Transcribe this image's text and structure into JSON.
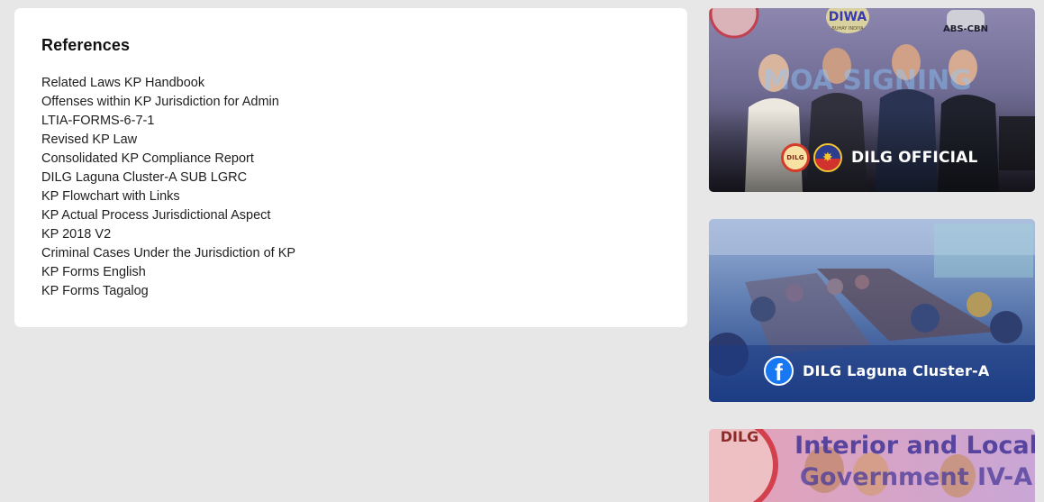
{
  "references": {
    "title": "References",
    "items": [
      "Related Laws KP Handbook",
      "Offenses within KP Jurisdiction for Admin",
      "LTIA-FORMS-6-7-1",
      "Revised KP Law",
      "Consolidated KP Compliance Report",
      "DILG Laguna Cluster-A SUB LGRC",
      "KP Flowchart with Links",
      "KP Actual Process Jurisdictional Aspect",
      "KP 2018 V2",
      "Criminal Cases Under the Jurisdiction of KP",
      "KP Forms English",
      "KP Forms Tagalog"
    ]
  },
  "banners": {
    "official": {
      "caption": "DILG OFFICIAL",
      "seal_text": "DILG",
      "backdrop_text": "MOA SIGNING",
      "top_logo": "DIWA",
      "top_logo_sub": "BUHAY INDIYA",
      "network": "ABS-CBN"
    },
    "facebook": {
      "caption": "DILG Laguna Cluster-A",
      "icon_glyph": "f"
    },
    "regional": {
      "line1": "Interior and Local",
      "line2": "Government IV-A",
      "seal_text": "DILG"
    }
  },
  "colors": {
    "page_bg": "#e7e7e7",
    "card_bg": "#ffffff",
    "facebook_blue": "#1877f2"
  }
}
